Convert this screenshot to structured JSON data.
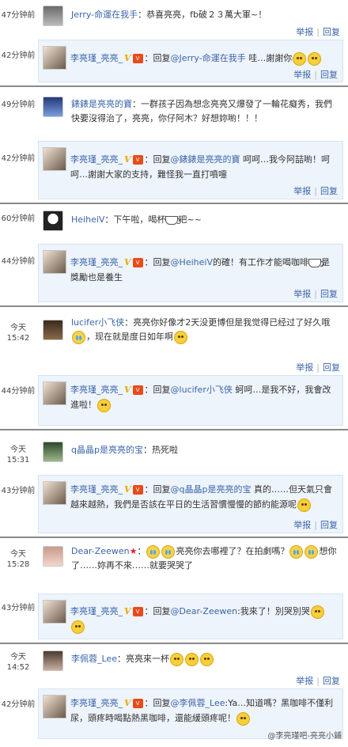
{
  "actions": {
    "report": "举报",
    "reply": "回复"
  },
  "reply_prefix": "回复",
  "replier": "李亮瑾_亮亮_",
  "threads": [
    {
      "time": "47分钟前",
      "user": "Jerry-命運在我手",
      "text": "恭喜亮亮，fb破２３萬大軍~！",
      "reply_time": "42分钟前",
      "reply_mention": "@Jerry-命運在我手",
      "reply_text": " 哇…謝謝你"
    },
    {
      "time": "49分钟前",
      "user": "錶錶是亮亮的寶",
      "text": "一群孩子因為想念亮亮又爆發了一輪花癡秀，我們快要沒得治了，亮亮，你仔阿木？好想妳喲！！！",
      "reply_time": "42分钟前",
      "reply_mention": "@錶錶是亮亮的寶",
      "reply_text": " 呵呵…我今阿喆喲！呵呵…謝謝大家的支持，難怪我一直打噴嚏"
    },
    {
      "time": "60分钟前",
      "user": "HeiheiV",
      "text": "下午啦，喝杯",
      "text_after": "吧~~",
      "reply_time": "44分钟前",
      "reply_mention": "@HeiheiV",
      "reply_text": "的確！有工作才能喝咖啡",
      "reply_after": "是獎勵也是養生"
    },
    {
      "time": "今天 15:42",
      "user": "lucifer小飞侠",
      "text": "亮亮你好像才2天没更博但是我觉得已经过了好久哦",
      "text_after": "，现在就是度日如年啊",
      "reply_time": "44分钟前",
      "reply_mention": "@lucifer小飞侠",
      "reply_text": " 蚵呵…是我不好，我會改進啦！"
    },
    {
      "time": "今天 15:31",
      "user": "q晶晶p是亮亮的宝",
      "text": "热死啦",
      "reply_time": "43分钟前",
      "reply_mention": "@q晶晶p是亮亮的宝",
      "reply_text": " 真的……但天氣只會越來越熱，我們是否該在平日的生活習慣慢慢的節約能源呢"
    },
    {
      "time": "今天 15:28",
      "user": "Dear-Zeewen",
      "text": "亮亮你去哪裡了？在拍劇嗎？",
      "text_after": "想你了……妳再不來……就要哭哭了",
      "reply_time": "43分钟前",
      "reply_mention": "@Dear-Zeewen",
      "reply_text": ":我來了！別哭別哭"
    },
    {
      "time": "今天 14:52",
      "user": "李佩蓉_Lee",
      "text": "亮亮來一杯",
      "reply_time": "42分钟前",
      "reply_mention": "@李佩蓉_Lee",
      "reply_text": ":Ya…知道嗎？黑咖啡不僅利尿，頭疼時喝點熱黑咖啡，還能緩頭疼呢！"
    }
  ],
  "watermark": "@李亮瑾吧-亮亮小鋪"
}
